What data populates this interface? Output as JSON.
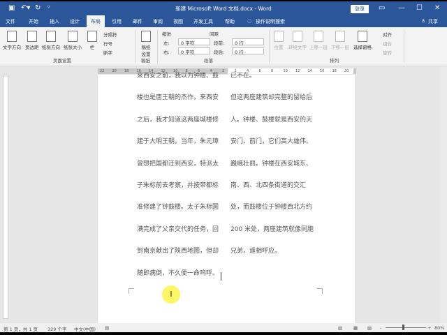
{
  "title": "新建 Microsoft Word 文档.docx - Word",
  "login": "登录",
  "tabs": [
    "文件",
    "开始",
    "插入",
    "设计",
    "布局",
    "引用",
    "邮件",
    "审阅",
    "视图",
    "开发工具",
    "帮助"
  ],
  "tell_me": "操作说明搜索",
  "share": "共享",
  "ribbon": {
    "page_setup": {
      "text_direction": "文字方向",
      "margins": "页边距",
      "orientation": "纸张方向",
      "size": "纸张大小",
      "columns": "栏",
      "breaks": "分隔符",
      "line_numbers": "行号",
      "hyphenation": "断字",
      "label": "页面设置"
    },
    "manuscript": {
      "settings": "稿纸设置",
      "label": "稿纸"
    },
    "paragraph": {
      "indent": "缩进",
      "spacing": "间距",
      "left": "左:",
      "right": "右:",
      "before": "段前:",
      "after": "段后:",
      "left_val": "0 字符",
      "right_val": "0 字符",
      "before_val": "0 行",
      "after_val": "0 行",
      "label": "段落"
    },
    "arrange": {
      "position": "位置",
      "wrap": "环绕文字",
      "forward": "上移一层",
      "backward": "下移一层",
      "pane": "选择窗格",
      "align": "对齐",
      "group": "组合",
      "rotate": "旋转",
      "label": "排列"
    }
  },
  "ruler": [
    "22",
    "20",
    "18",
    "16",
    "14",
    "12",
    "10",
    "8",
    "6",
    "4",
    "2",
    "2",
    "4",
    "6",
    "8",
    "10",
    "12",
    "14",
    "16",
    "18",
    "20"
  ],
  "doc": {
    "col1": [
      "来西安之前，我以为钟楼、鼓",
      "楼也是唐王朝的杰作，来西安",
      "之后，我才知道这两座城楼修",
      "建于大明王朝。当年，朱元璋",
      "曾想把国都迁到西安，特派太",
      "子朱标前去考察，并按帝都标",
      "准修建了钟鼓楼。太子朱标圆",
      "满完成了父亲交代的任务，回",
      "到南京献出了陕西地图，但却",
      "随即病倒，不久便一命呜呼。"
    ],
    "col2": [
      "已不在。",
      "但这两座建筑却完整的留给后",
      "人。钟楼、鼓楼就是西安的天",
      "安门、前门，它们高大雄伟、",
      "巍峨壮丽。钟楼在西安城东、",
      "南、西、北四条街道的交汇",
      "处，而鼓楼位于钟楼西北方约",
      "200 米处，两座建筑就像同胞",
      "兄弟，遥相呼应。"
    ]
  },
  "status": {
    "page": "第 1 页，共 1 页",
    "words": "329 个字",
    "lang": "中文(中国)",
    "zoom": "80%"
  }
}
